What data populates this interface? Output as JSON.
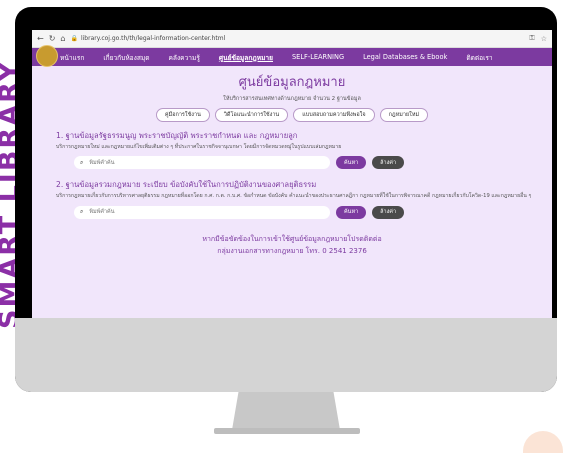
{
  "side_text": "SMART LIBRARY",
  "browser": {
    "url": "library.coj.go.th/th/legal-information-center.html",
    "icons": [
      "back-icon",
      "forward-icon",
      "reload-icon",
      "home-icon",
      "lock-icon",
      "key-icon",
      "star-icon"
    ]
  },
  "nav": {
    "items": [
      "หน้าแรก",
      "เกี่ยวกับห้องสมุด",
      "คลังความรู้",
      "ศูนย์ข้อมูลกฎหมาย",
      "SELF-LEARNING",
      "Legal Databases & Ebook",
      "ติดต่อเรา"
    ],
    "active_index": 3
  },
  "page": {
    "title": "ศูนย์ข้อมูลกฎหมาย",
    "subtitle": "ให้บริการสารสนเทศทางด้านกฎหมาย จำนวน 2 ฐานข้อมูล",
    "pills": [
      "คู่มือการใช้งาน",
      "วิดีโอแนะนำการใช้งาน",
      "แบบสอบถามความพึงพอใจ",
      "กฎหมายใหม่"
    ]
  },
  "sections": [
    {
      "title": "1. ฐานข้อมูลรัฐธรรมนูญ พระราชบัญญัติ พระราชกำหนด และ กฎหมายลูก",
      "description": "บริการกฎหมายใหม่ และกฎหมายแก้ไขเพิ่มเติมต่าง ๆ ที่ประกาศในราชกิจจานุเบกษา โดยมีการจัดหมวดหมู่ในรูปแบบเล่มกฎหมาย",
      "search_placeholder": "พิมพ์คำค้น",
      "search_button": "ค้นหา",
      "clear_button": "ล้างค่า"
    },
    {
      "title": "2. ฐานข้อมูลรวมกฎหมาย ระเบียบ ข้อบังคับใช้ในการปฏิบัติงานของศาลยุติธรรม",
      "description": "บริการกฎหมายเกี่ยวกับการบริหารศาลยุติธรรม กฎหมายที่ออกโดย ก.ศ. ก.ต. ก.บ.ศ. ข้อกำหนด ข้อบังคับ คำแนะนำของประธานศาลฎีกา กฎหมายที่ใช้ในการพิจารณาคดี กฎหมายเกี่ยวกับโควิด-19 และกฎหมายอื่น ๆ",
      "search_placeholder": "พิมพ์คำค้น",
      "search_button": "ค้นหา",
      "clear_button": "ล้างค่า"
    }
  ],
  "contact": {
    "line1": "หากมีข้อขัดข้องในการเข้าใช้ศูนย์ข้อมูลกฎหมายโปรดติดต่อ",
    "line2": "กลุ่มงานเอกสารทางกฎหมาย โทร. 0 2541 2376"
  }
}
